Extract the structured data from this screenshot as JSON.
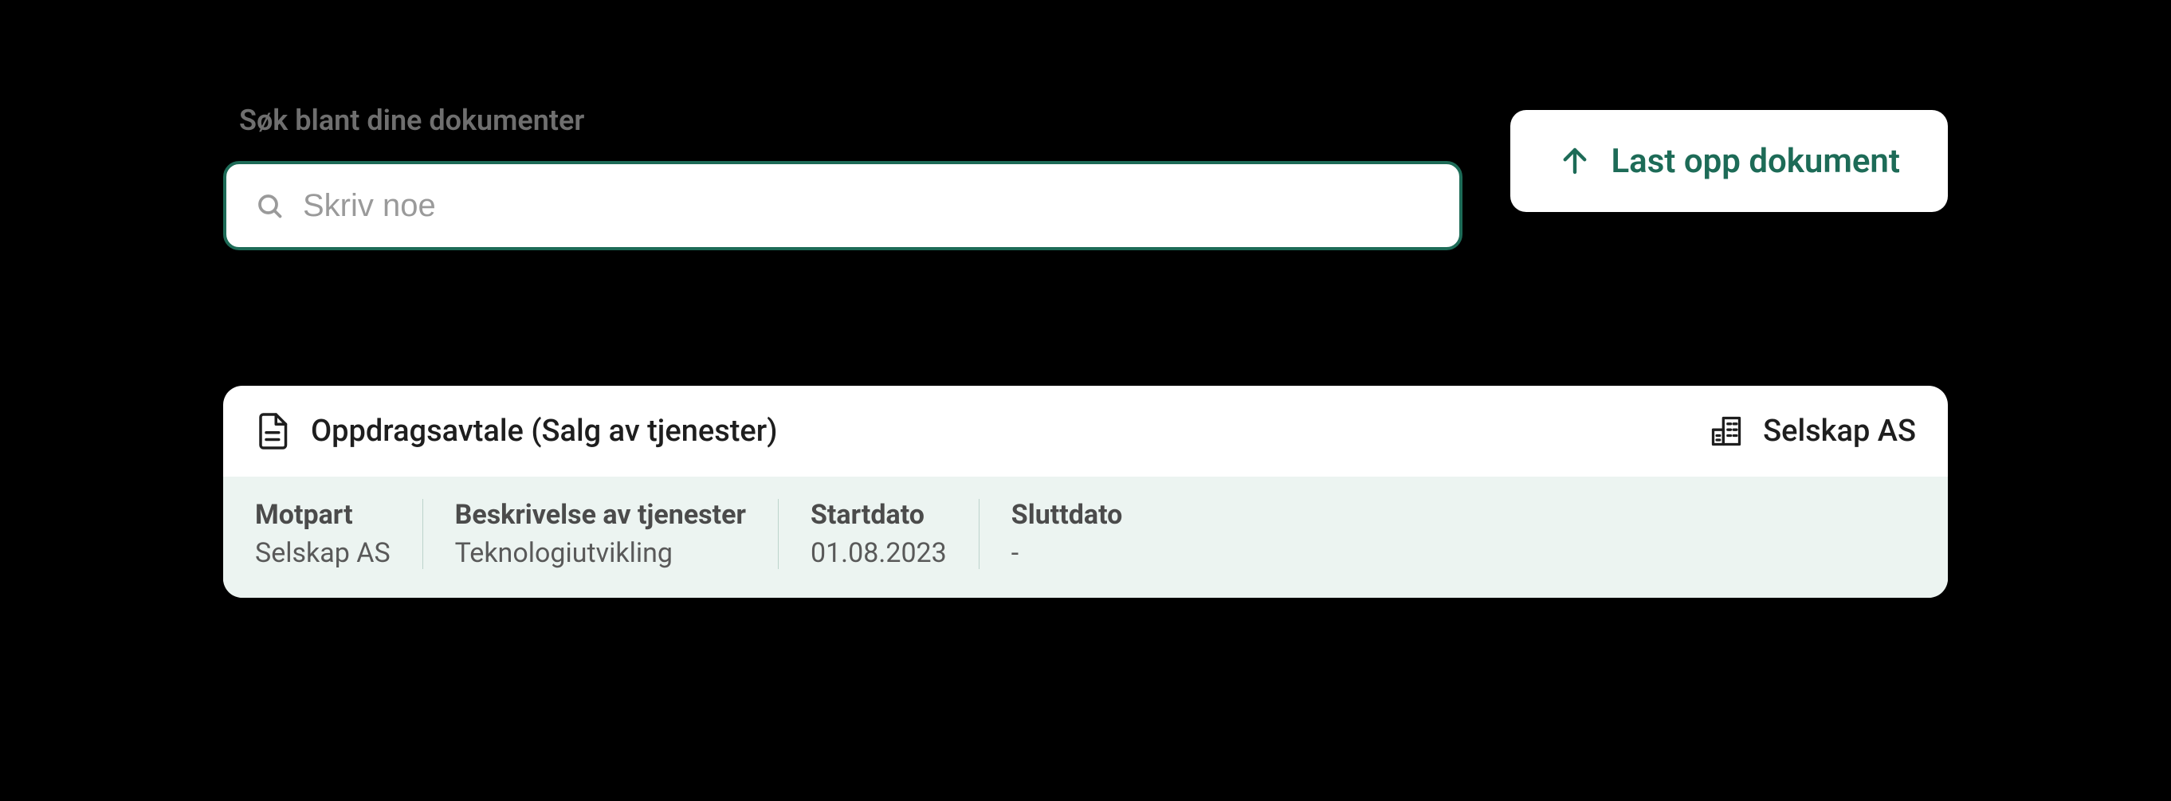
{
  "search": {
    "label": "Søk blant dine dokumenter",
    "placeholder": "Skriv noe"
  },
  "upload": {
    "label": "Last opp dokument"
  },
  "document": {
    "title": "Oppdragsavtale (Salg av tjenester)",
    "company": "Selskap AS",
    "fields": {
      "motpart": {
        "label": "Motpart",
        "value": "Selskap AS"
      },
      "beskrivelse": {
        "label": "Beskrivelse av tjenester",
        "value": "Teknologiutvikling"
      },
      "startdato": {
        "label": "Startdato",
        "value": "01.08.2023"
      },
      "sluttdato": {
        "label": "Sluttdato",
        "value": "-"
      }
    }
  },
  "colors": {
    "accent": "#1d6b57",
    "panel": "#ecf4f1"
  }
}
